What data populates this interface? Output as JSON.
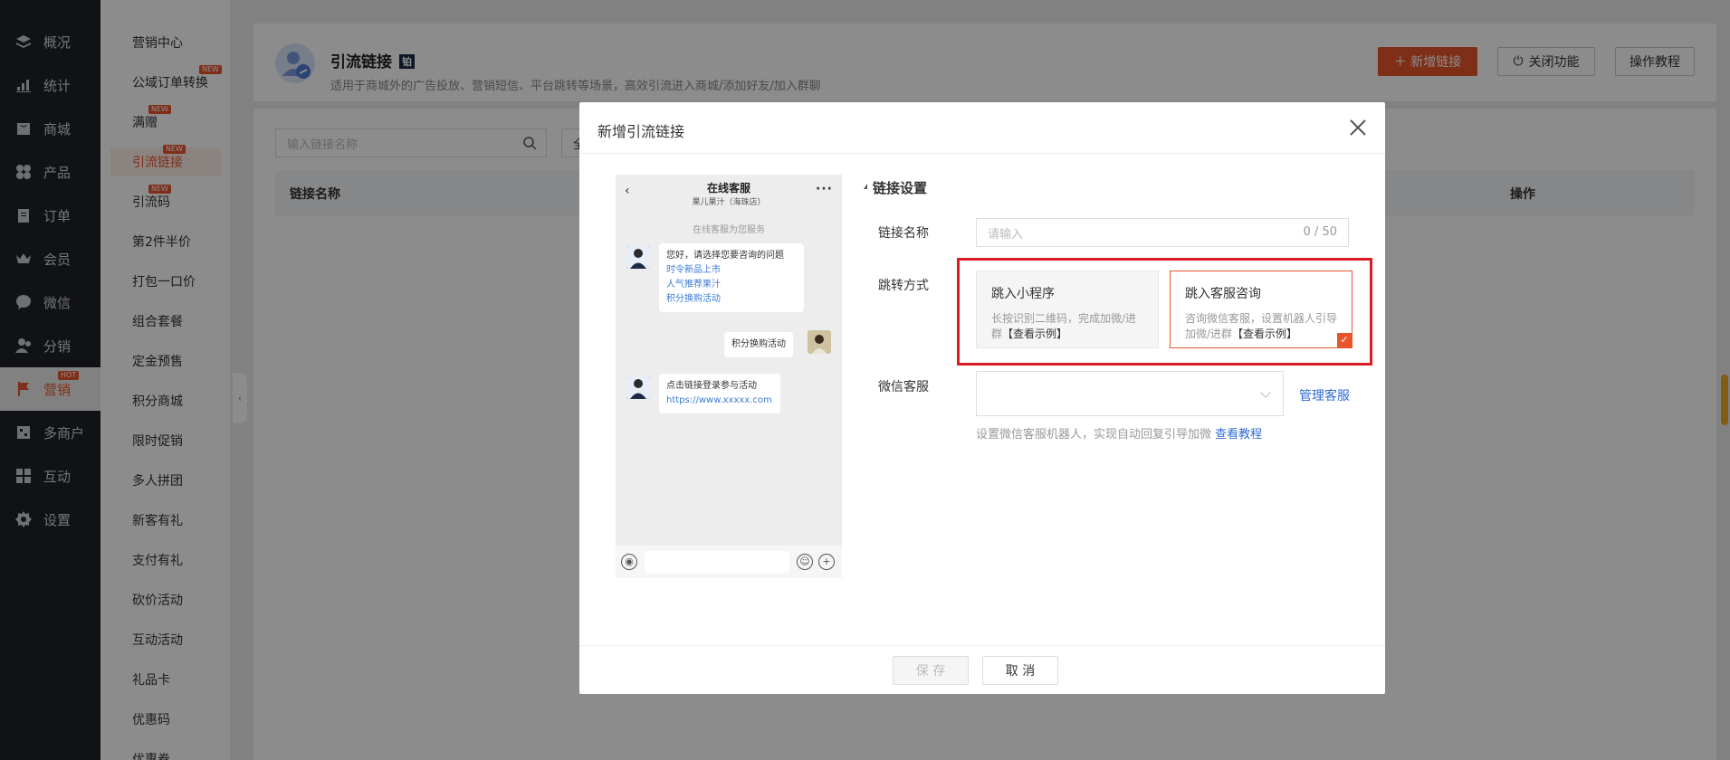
{
  "nav": {
    "items": [
      {
        "label": "概况",
        "icon": "dashboard-icon"
      },
      {
        "label": "统计",
        "icon": "stats-icon"
      },
      {
        "label": "商城",
        "icon": "shop-icon"
      },
      {
        "label": "产品",
        "icon": "product-icon"
      },
      {
        "label": "订单",
        "icon": "order-icon"
      },
      {
        "label": "会员",
        "icon": "crown-icon"
      },
      {
        "label": "微信",
        "icon": "wechat-icon"
      },
      {
        "label": "分销",
        "icon": "distribution-icon"
      },
      {
        "label": "营销",
        "icon": "flag-icon",
        "badge": "HOT"
      },
      {
        "label": "多商户",
        "icon": "merchant-icon"
      },
      {
        "label": "互动",
        "icon": "interact-icon"
      },
      {
        "label": "设置",
        "icon": "gear-icon"
      }
    ]
  },
  "subnav": {
    "items": [
      {
        "label": "营销中心"
      },
      {
        "label": "公域订单转换",
        "badge": "NEW"
      },
      {
        "label": "满赠",
        "badge": "NEW"
      },
      {
        "label": "引流链接",
        "badge": "NEW"
      },
      {
        "label": "引流码",
        "badge": "NEW"
      },
      {
        "label": "第2件半价"
      },
      {
        "label": "打包一口价"
      },
      {
        "label": "组合套餐"
      },
      {
        "label": "定金预售"
      },
      {
        "label": "积分商城"
      },
      {
        "label": "限时促销"
      },
      {
        "label": "多人拼团"
      },
      {
        "label": "新客有礼"
      },
      {
        "label": "支付有礼"
      },
      {
        "label": "砍价活动"
      },
      {
        "label": "互动活动"
      },
      {
        "label": "礼品卡"
      },
      {
        "label": "优惠码"
      },
      {
        "label": "优惠券"
      }
    ]
  },
  "header": {
    "title": "引流链接",
    "badge": "铂",
    "subtitle": "适用于商城外的广告投放、营销短信、平台跳转等场景，高效引流进入商城/添加好友/加入群聊",
    "new_button": "＋ 新增链接",
    "close_button": "关闭功能",
    "tutorial_button": "操作教程"
  },
  "list": {
    "search_placeholder": "输入链接名称",
    "filter_partial": "全",
    "columns": {
      "name": "链接名称",
      "actions": "操作"
    }
  },
  "modal": {
    "title": "新增引流链接",
    "phone": {
      "title": "在线客服",
      "subtitle": "果儿果汁（海珠店）",
      "system": "在线客服为您服务",
      "msg1_text": "您好，请选择您要咨询的问题",
      "msg1_links": [
        "时令新品上市",
        "人气推荐果汁",
        "积分换购活动"
      ],
      "user_msg": "积分换购活动",
      "msg2_text": "点击链接登录参与活动",
      "msg2_link": "https://www.xxxxx.com"
    },
    "section_title": "链接设置",
    "name_label": "链接名称",
    "name_placeholder": "请输入",
    "name_counter": "0 / 50",
    "jump_label": "跳转方式",
    "option1": {
      "title": "跳入小程序",
      "desc": "长按识别二维码，完成加微/进群",
      "example": "【查看示例】"
    },
    "option2": {
      "title": "跳入客服咨询",
      "desc": "咨询微信客服，设置机器人引导加微/进群",
      "example": "【查看示例】"
    },
    "wechat_label": "微信客服",
    "manage_link": "管理客服",
    "hint": "设置微信客服机器人，实现自动回复引导加微",
    "hint_link": "查看教程",
    "save": "保 存",
    "cancel": "取 消"
  },
  "colors": {
    "accent": "#e8552d",
    "link": "#2f6bd6",
    "highlight": "#e01c23",
    "nav_bg": "#1f2229"
  }
}
